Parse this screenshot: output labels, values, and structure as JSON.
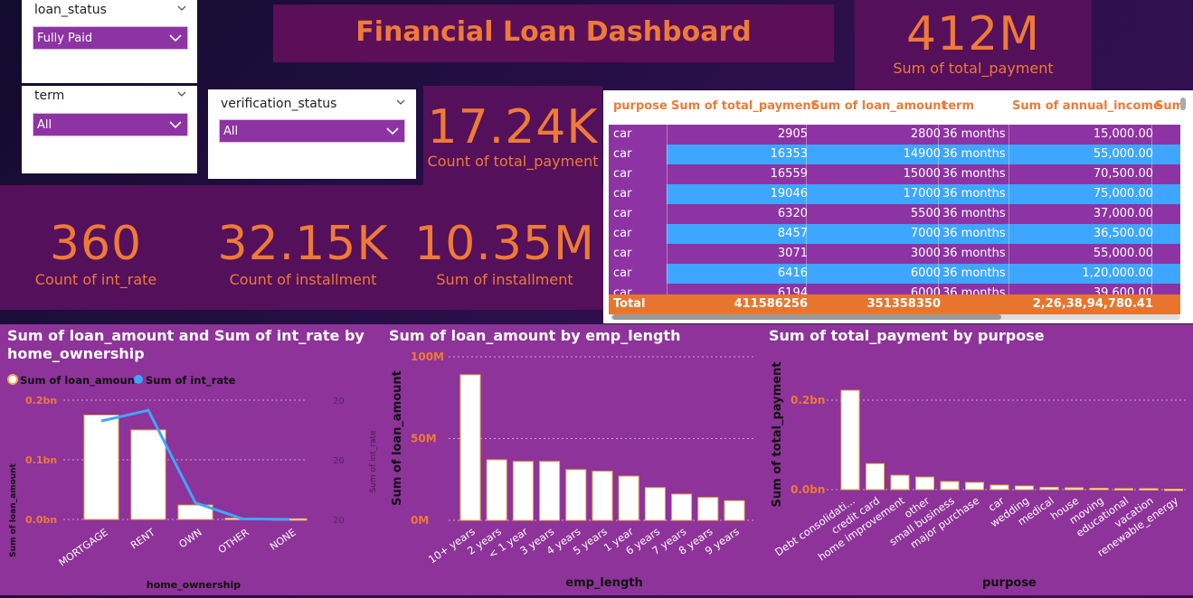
{
  "slicers": {
    "loan_status": {
      "title": "loan_status",
      "value": "Fully Paid"
    },
    "term": {
      "title": "term",
      "value": "All"
    },
    "verification_status": {
      "title": "verification_status",
      "value": "All"
    }
  },
  "title": "Financial Loan Dashboard",
  "kpis": {
    "sum_total_payment": {
      "value": "412M",
      "label": "Sum of total_payment"
    },
    "count_total_payment": {
      "value": "17.24K",
      "label": "Count of total_payment"
    },
    "count_int_rate": {
      "value": "360",
      "label": "Count of int_rate"
    },
    "count_installment": {
      "value": "32.15K",
      "label": "Count of installment"
    },
    "sum_installment": {
      "value": "10.35M",
      "label": "Sum of installment"
    }
  },
  "table": {
    "columns": [
      "purpose",
      "Sum of total_payment",
      "Sum of loan_amount",
      "term",
      "Sum of annual_income",
      "Sum"
    ],
    "rows": [
      [
        "car",
        "2905",
        "2800",
        "36 months",
        "15,000.00"
      ],
      [
        "car",
        "16353",
        "14900",
        "36 months",
        "55,000.00"
      ],
      [
        "car",
        "16559",
        "15000",
        "36 months",
        "70,500.00"
      ],
      [
        "car",
        "19046",
        "17000",
        "36 months",
        "75,000.00"
      ],
      [
        "car",
        "6320",
        "5500",
        "36 months",
        "37,000.00"
      ],
      [
        "car",
        "8457",
        "7000",
        "36 months",
        "36,500.00"
      ],
      [
        "car",
        "3071",
        "3000",
        "36 months",
        "55,000.00"
      ],
      [
        "car",
        "6416",
        "6000",
        "36 months",
        "1,20,000.00"
      ],
      [
        "car",
        "6194",
        "6000",
        "36 months",
        "39,600.00"
      ]
    ],
    "total": [
      "Total",
      "411586256",
      "351358350",
      "",
      "2,26,38,94,780.41"
    ]
  },
  "colors": {
    "accent": "#ee7a37",
    "panel": "#8d3399",
    "row_purple": "#8e33a3",
    "row_blue": "#3ea6ff",
    "line_blue": "#3ea6ff",
    "bar_fill": "#ffffff",
    "bar_stroke": "#e8b04a"
  },
  "chart_data": [
    {
      "type": "bar",
      "title_line1": "Sum of loan_amount and Sum of int_rate by",
      "title_line2": "home_ownership",
      "legend": [
        "Sum of loan_amount",
        "Sum of int_rate"
      ],
      "categories": [
        "MORTGAGE",
        "RENT",
        "OWN",
        "OTHER",
        "NONE"
      ],
      "series": [
        {
          "name": "Sum of loan_amount",
          "type": "bar",
          "values": [
            0.175,
            0.15,
            0.024,
            0.002,
            0.001
          ]
        },
        {
          "name": "Sum of int_rate",
          "type": "line",
          "values": [
            0.165,
            0.183,
            0.028,
            0.001,
            0.0
          ]
        }
      ],
      "yticks": [
        "0.0bn",
        "0.1bn",
        "0.2bn"
      ],
      "ylim": [
        0,
        0.2
      ],
      "ylabel": "Sum of loan_amount",
      "y2label": "Sum of int_rate",
      "xlabel": "home_ownership"
    },
    {
      "type": "bar",
      "title": "Sum of loan_amount by emp_length",
      "categories": [
        "10+ years",
        "2 years",
        "< 1 year",
        "3 years",
        "4 years",
        "5 years",
        "1 year",
        "6 years",
        "7 years",
        "8 years",
        "9 years"
      ],
      "values": [
        89,
        37,
        36,
        36,
        31,
        30,
        27,
        20,
        16,
        14,
        12
      ],
      "yticks": [
        "0M",
        "50M",
        "100M"
      ],
      "ylim": [
        0,
        100
      ],
      "ylabel": "Sum of loan_amount",
      "xlabel": "emp_length"
    },
    {
      "type": "bar",
      "title": "Sum of total_payment by purpose",
      "categories": [
        "Debt consolidati...",
        "credit card",
        "home improvement",
        "other",
        "small business",
        "major purchase",
        "car",
        "wedding",
        "medical",
        "house",
        "moving",
        "educational",
        "vacation",
        "renewable_energy"
      ],
      "values": [
        0.222,
        0.058,
        0.032,
        0.028,
        0.018,
        0.016,
        0.01,
        0.008,
        0.005,
        0.004,
        0.003,
        0.002,
        0.002,
        0.001
      ],
      "yticks": [
        "0.0bn",
        "0.2bn"
      ],
      "ylim": [
        0,
        0.25
      ],
      "ylabel": "Sum of total_payment",
      "xlabel": "purpose"
    }
  ]
}
